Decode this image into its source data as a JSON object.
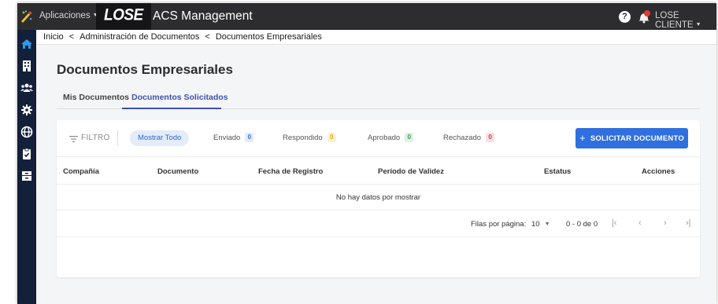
{
  "topbar": {
    "apps_label": "Aplicaciones",
    "logo_text": "LOSE",
    "app_title": "ACS Management",
    "help_symbol": "?",
    "user_label": "LOSE CLIENTE",
    "notification_count": 1
  },
  "breadcrumb": {
    "items": [
      "Inicio",
      "Administración de Documentos",
      "Documentos Empresariales"
    ],
    "separator": "<"
  },
  "page": {
    "title": "Documentos Empresariales",
    "tabs": [
      {
        "label": "Mis Documentos",
        "active": false
      },
      {
        "label": "Documentos Solicitados",
        "active": true
      }
    ]
  },
  "filters": {
    "label": "FILTRO",
    "show_all": "Mostrar Todo",
    "chips": [
      {
        "label": "Enviado",
        "count": "0",
        "color": "#2f6fdf",
        "bg": "#e3ecfb"
      },
      {
        "label": "Respondido",
        "count": "0",
        "color": "#e6a800",
        "bg": "#fdf3d2"
      },
      {
        "label": "Aprobado",
        "count": "0",
        "color": "#2e9d4f",
        "bg": "#dff2e4"
      },
      {
        "label": "Rechazado",
        "count": "0",
        "color": "#e0353a",
        "bg": "#fbe1e1"
      }
    ],
    "request_button": "SOLICITAR DOCUMENTO"
  },
  "table": {
    "columns": [
      "Compañía",
      "Documento",
      "Fecha de Registro",
      "Período de Validez",
      "Estatus",
      "Acciones"
    ],
    "empty_message": "No hay datos por mostrar"
  },
  "pagination": {
    "rows_per_page_label": "Filas por página:",
    "rows_per_page_value": "10",
    "range_text": "0 - 0 de 0"
  },
  "colors": {
    "topbar": "#2d2d2f",
    "sidebar": "#13203a",
    "accent": "#3f51b5",
    "primary_button": "#2f6fdf"
  }
}
